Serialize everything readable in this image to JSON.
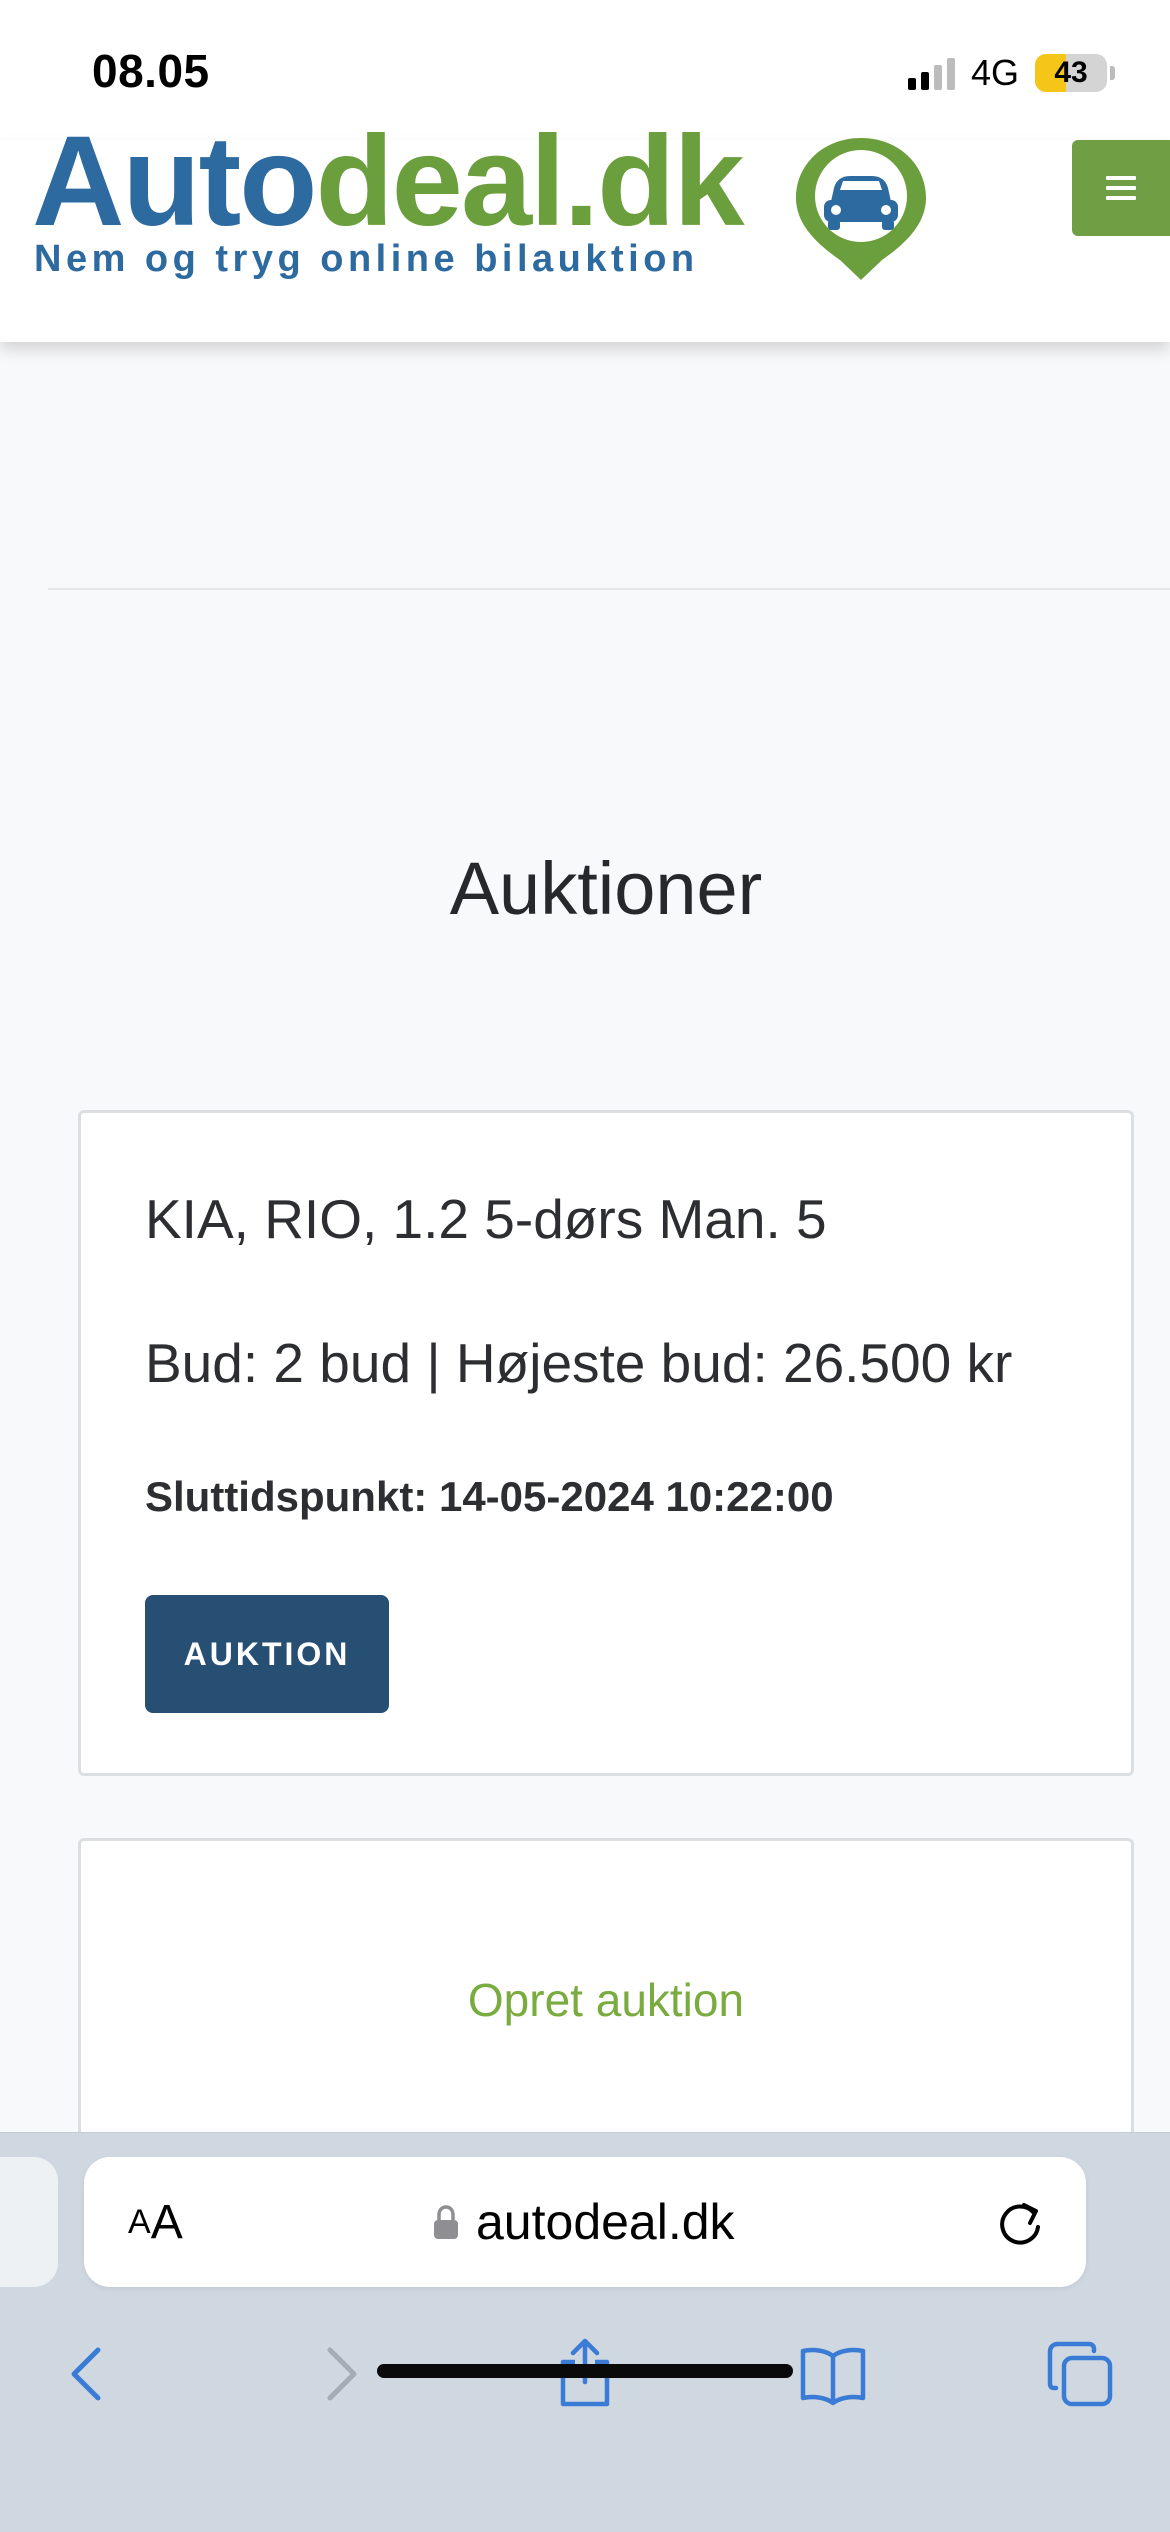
{
  "status_bar": {
    "time": "08.05",
    "network": "4G",
    "battery": "43",
    "battery_level": 0.43
  },
  "header": {
    "logo_part1": "Auto",
    "logo_part2": "deal.dk",
    "logo_tagline": "Nem og tryg online bilauktion",
    "menu_icon": "hamburger-menu-icon"
  },
  "colors": {
    "brand_blue": "#2d6a9f",
    "brand_green": "#6b9e3c",
    "button_navy": "#264f73",
    "link_green": "#7aab3f",
    "ios_blue": "#3a7bd5"
  },
  "main": {
    "title": "Auktioner",
    "auction_card": {
      "title": "KIA, RIO, 1.2 5-dørs Man. 5",
      "bids": "Bud: 2 bud | Højeste bud: 26.500 kr",
      "end_time": "Sluttidspunkt: 14-05-2024 10:22:00",
      "button_label": "AUKTION"
    },
    "create_card": {
      "link_label": "Opret auktion"
    }
  },
  "browser": {
    "aa_small": "A",
    "aa_big": "A",
    "url": "autodeal.dk",
    "icons": [
      "lock-icon",
      "reload-icon",
      "back-icon",
      "forward-icon",
      "share-icon",
      "bookmarks-icon",
      "tabs-icon"
    ]
  }
}
